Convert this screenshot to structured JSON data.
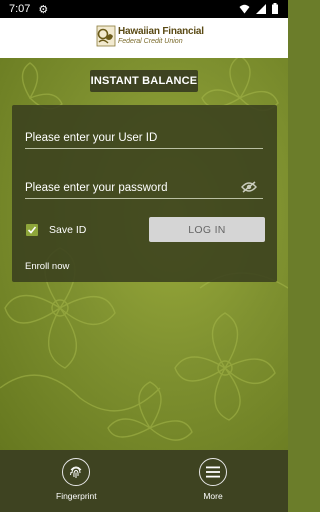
{
  "status_bar": {
    "time": "7:07"
  },
  "header": {
    "logo_title": "Hawaiian Financial",
    "logo_subtitle": "Federal Credit Union"
  },
  "instant_balance": {
    "label": "INSTANT BALANCE"
  },
  "login": {
    "user_id_placeholder": "Please enter your User ID",
    "password_placeholder": "Please enter your password",
    "save_id_label": "Save ID",
    "save_id_checked": true,
    "login_label": "LOG IN",
    "enroll_label": "Enroll now"
  },
  "bottom_nav": {
    "fingerprint_label": "Fingerprint",
    "more_label": "More"
  },
  "colors": {
    "accent": "#3e4321",
    "check": "#8ea63a",
    "background": "#7f9130"
  }
}
